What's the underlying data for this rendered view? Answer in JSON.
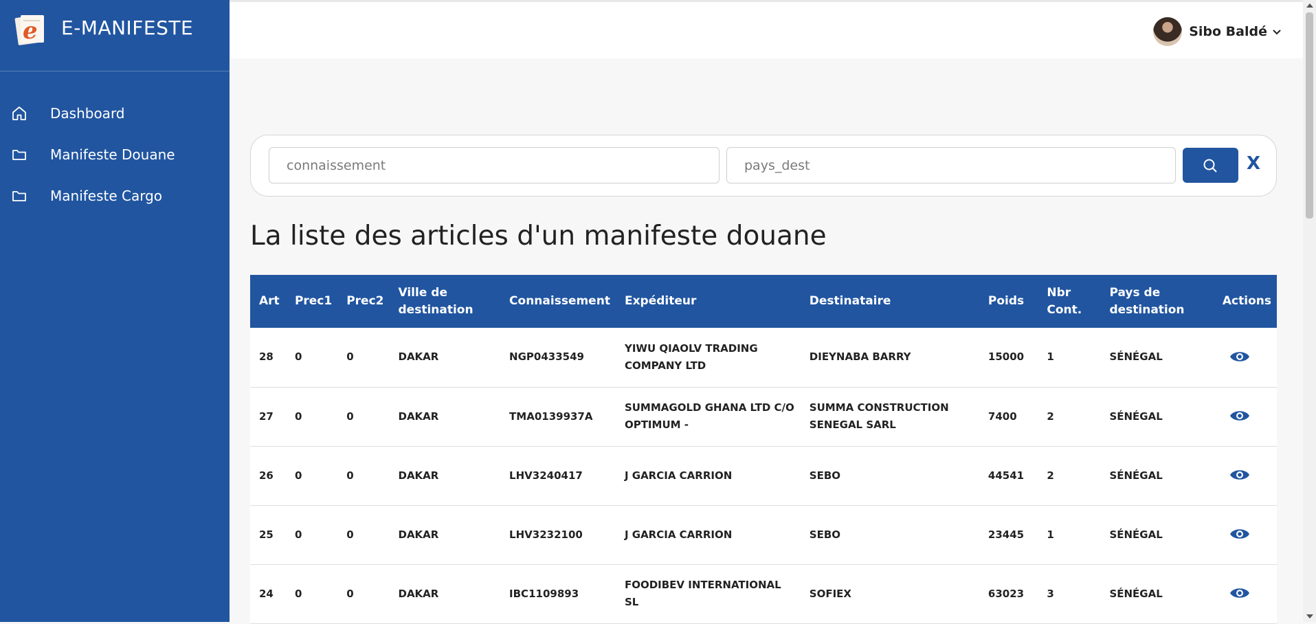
{
  "app": {
    "title": "E-MANIFESTE"
  },
  "sidebar": {
    "items": [
      {
        "label": "Dashboard",
        "icon": "home-icon"
      },
      {
        "label": "Manifeste Douane",
        "icon": "folder-icon"
      },
      {
        "label": "Manifeste Cargo",
        "icon": "folder-icon"
      }
    ]
  },
  "user": {
    "name": "Sibo Baldé"
  },
  "search": {
    "connaissement_placeholder": "connaissement",
    "pays_placeholder": "pays_dest",
    "clear_label": "X"
  },
  "page": {
    "title": "La liste des articles d'un manifeste douane"
  },
  "table": {
    "headers": {
      "art": "Art",
      "prec1": "Prec1",
      "prec2": "Prec2",
      "ville_l1": "Ville de",
      "ville_l2": "destination",
      "connaissement": "Connaissement",
      "expediteur": "Expéditeur",
      "destinataire": "Destinataire",
      "poids": "Poids",
      "nbr_l1": "Nbr",
      "nbr_l2": "Cont.",
      "pays_l1": "Pays de",
      "pays_l2": "destination",
      "actions": "Actions"
    },
    "rows": [
      {
        "art": "28",
        "prec1": "0",
        "prec2": "0",
        "ville": "DAKAR",
        "connaissement": "NGP0433549",
        "expediteur": "YIWU QIAOLV TRADING COMPANY LTD",
        "destinataire": "DIEYNABA BARRY",
        "poids": "15000",
        "nbr": "1",
        "pays": "SÉNÉGAL"
      },
      {
        "art": "27",
        "prec1": "0",
        "prec2": "0",
        "ville": "DAKAR",
        "connaissement": "TMA0139937A",
        "expediteur": "SUMMAGOLD GHANA LTD C/O OPTIMUM -",
        "destinataire": "SUMMA CONSTRUCTION SENEGAL SARL",
        "poids": "7400",
        "nbr": "2",
        "pays": "SÉNÉGAL"
      },
      {
        "art": "26",
        "prec1": "0",
        "prec2": "0",
        "ville": "DAKAR",
        "connaissement": "LHV3240417",
        "expediteur": "J GARCIA CARRION",
        "destinataire": "SEBO",
        "poids": "44541",
        "nbr": "2",
        "pays": "SÉNÉGAL"
      },
      {
        "art": "25",
        "prec1": "0",
        "prec2": "0",
        "ville": "DAKAR",
        "connaissement": "LHV3232100",
        "expediteur": "J GARCIA CARRION",
        "destinataire": "SEBO",
        "poids": "23445",
        "nbr": "1",
        "pays": "SÉNÉGAL"
      },
      {
        "art": "24",
        "prec1": "0",
        "prec2": "0",
        "ville": "DAKAR",
        "connaissement": "IBC1109893",
        "expediteur": "FOODIBEV INTERNATIONAL SL",
        "destinataire": "SOFIEX",
        "poids": "63023",
        "nbr": "3",
        "pays": "SÉNÉGAL"
      }
    ]
  },
  "colors": {
    "brand": "#2155a0",
    "background": "#f7f7f7"
  }
}
